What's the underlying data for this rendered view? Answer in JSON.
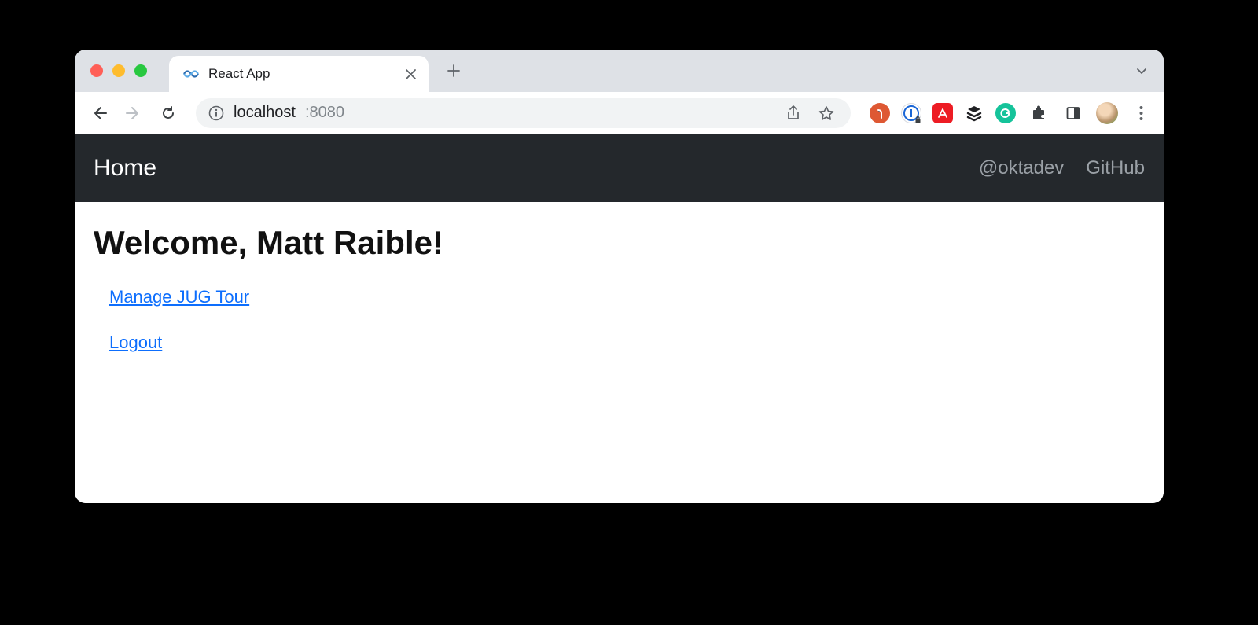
{
  "browser": {
    "tab_title": "React App",
    "url_host": "localhost",
    "url_port": ":8080"
  },
  "app": {
    "nav": {
      "brand": "Home",
      "links": [
        "@oktadev",
        "GitHub"
      ]
    },
    "heading": "Welcome, Matt Raible!",
    "links": {
      "manage": "Manage JUG Tour",
      "logout": "Logout"
    }
  }
}
